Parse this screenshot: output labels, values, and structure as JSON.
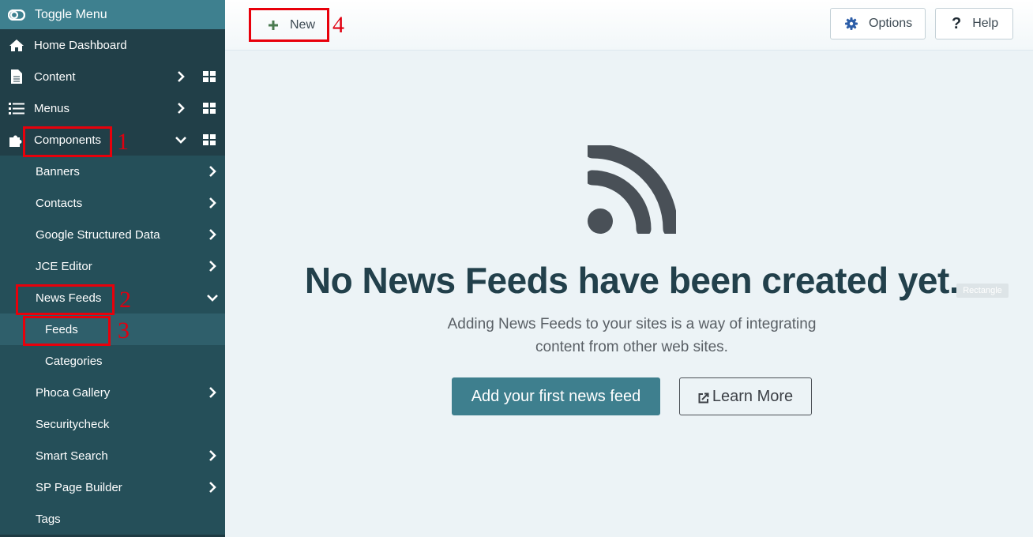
{
  "sidebar": {
    "toggle_label": "Toggle Menu",
    "items": [
      {
        "label": "Home Dashboard",
        "icon": "home-icon"
      },
      {
        "label": "Content",
        "icon": "file-icon",
        "expand": "chevron-right",
        "dashboard": true
      },
      {
        "label": "Menus",
        "icon": "list-icon",
        "expand": "chevron-right",
        "dashboard": true
      },
      {
        "label": "Components",
        "icon": "puzzle-icon",
        "expand": "chevron-down",
        "dashboard": true
      }
    ],
    "components_children": [
      {
        "label": "Banners",
        "expand": "chevron-right"
      },
      {
        "label": "Contacts",
        "expand": "chevron-right"
      },
      {
        "label": "Google Structured Data",
        "expand": "chevron-right"
      },
      {
        "label": "JCE Editor",
        "expand": "chevron-right"
      },
      {
        "label": "News Feeds",
        "expand": "chevron-down"
      },
      {
        "label": "Feeds",
        "active": true
      },
      {
        "label": "Categories"
      },
      {
        "label": "Phoca Gallery",
        "expand": "chevron-right"
      },
      {
        "label": "Securitycheck"
      },
      {
        "label": "Smart Search",
        "expand": "chevron-right"
      },
      {
        "label": "SP Page Builder",
        "expand": "chevron-right"
      },
      {
        "label": "Tags"
      }
    ]
  },
  "toolbar": {
    "new_label": "New",
    "options_label": "Options",
    "help_label": "Help"
  },
  "empty_state": {
    "icon": "rss-icon",
    "title": "No News Feeds have been created yet.",
    "description": "Adding News Feeds to your sites is a way of integrating content from other web sites.",
    "primary_button": "Add your first news feed",
    "secondary_button": "Learn More"
  },
  "overlay_label": "Rectangle",
  "annotations": [
    "1",
    "2",
    "3",
    "4"
  ],
  "colors": {
    "sidebar_bg": "#213f48",
    "toggle_bg": "#3e808f",
    "accent": "#3e7f8e",
    "annotation": "#e8000b"
  }
}
